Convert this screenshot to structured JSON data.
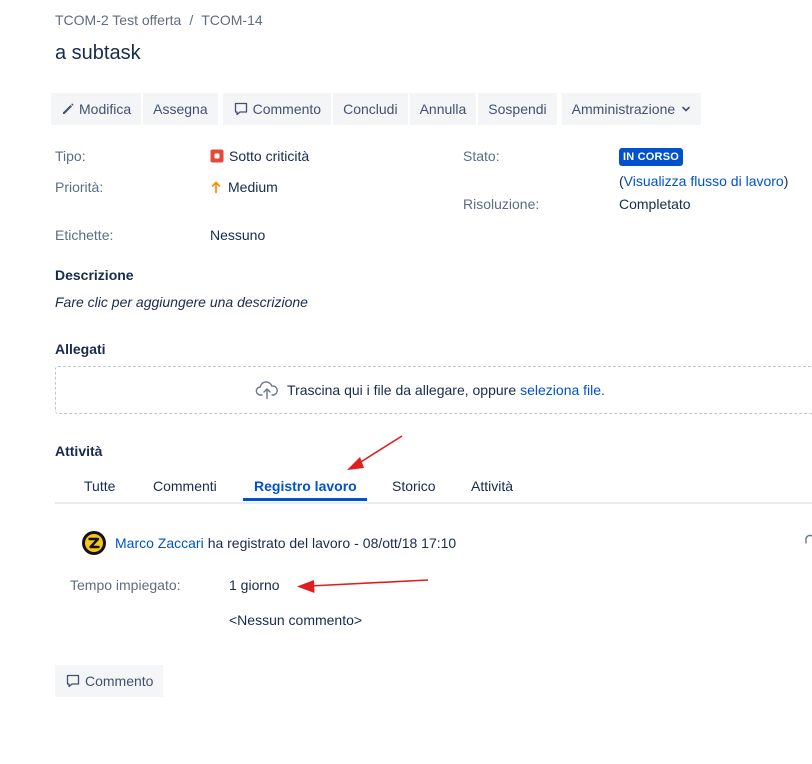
{
  "breadcrumb": {
    "project": "TCOM-2 Test offerta",
    "separator": "/",
    "issue_key": "TCOM-14"
  },
  "issue": {
    "title": "a subtask"
  },
  "toolbar": {
    "edit": "Modifica",
    "assign": "Assegna",
    "comment": "Commento",
    "conclude": "Concludi",
    "cancel": "Annulla",
    "suspend": "Sospendi",
    "admin": "Amministrazione"
  },
  "details": {
    "type_label": "Tipo:",
    "type_value": "Sotto criticità",
    "priority_label": "Priorità:",
    "priority_value": "Medium",
    "labels_label": "Etichette:",
    "labels_value": "Nessuno",
    "status_label": "Stato:",
    "status_value": "IN CORSO",
    "workflow_open": "(",
    "workflow_link": "Visualizza flusso di lavoro",
    "workflow_close": ")",
    "resolution_label": "Risoluzione:",
    "resolution_value": "Completato"
  },
  "description": {
    "heading": "Descrizione",
    "placeholder": "Fare clic per aggiungere una descrizione"
  },
  "attachments": {
    "heading": "Allegati",
    "drop_text": "Trascina qui i file da allegare, oppure",
    "select_link": "seleziona file."
  },
  "activity": {
    "heading": "Attività",
    "tabs": [
      "Tutte",
      "Commenti",
      "Registro lavoro",
      "Storico",
      "Attività"
    ],
    "active_tab": "Registro lavoro"
  },
  "worklog": {
    "author": "Marco Zaccari",
    "action": "ha registrato del lavoro",
    "dash": "-",
    "timestamp": "08/ott/18 17:10",
    "time_spent_label": "Tempo impiegato:",
    "time_spent_value": "1 giorno",
    "comment": "<Nessun commento>"
  },
  "footer": {
    "comment_button": "Commento"
  },
  "colors": {
    "accent": "#0052cc",
    "annotation_arrow": "#e01e1e",
    "priority_medium": "#ff8b00",
    "type_icon": "#e5493a"
  }
}
